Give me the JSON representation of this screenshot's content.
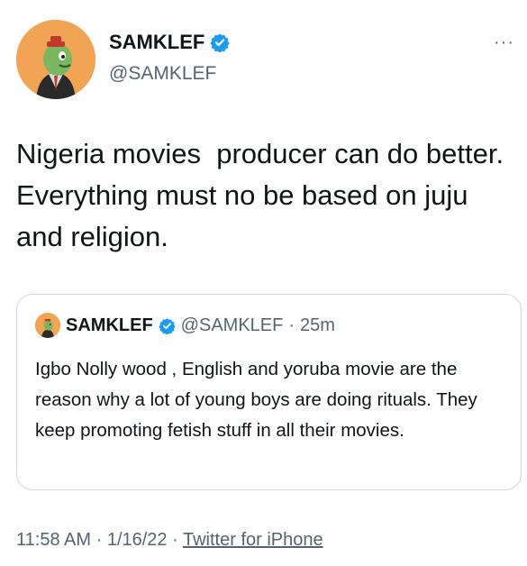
{
  "author": {
    "name": "SAMKLEF",
    "handle": "@SAMKLEF",
    "avatar_icon": "cartoon-character-avatar",
    "verified_icon": "verified-badge-icon"
  },
  "menu": {
    "more_label": "···"
  },
  "tweet": {
    "text": "Nigeria movies  producer can do better.  Everything must no be based on juju and religion."
  },
  "quote": {
    "name": "SAMKLEF",
    "handle": "@SAMKLEF",
    "separator": "·",
    "time": "25m",
    "text": "Igbo Nolly wood , English and yoruba movie are the reason why a lot of young boys are doing rituals. They keep promoting fetish stuff in all their movies."
  },
  "footer": {
    "time": "11:58 AM",
    "separator1": "·",
    "date": "1/16/22",
    "separator2": "·",
    "source": "Twitter for iPhone"
  },
  "colors": {
    "text": "#0f1419",
    "secondary": "#536471",
    "verified": "#1d9bf0",
    "avatar_bg": "#f2a455",
    "border": "#cfd9de"
  }
}
